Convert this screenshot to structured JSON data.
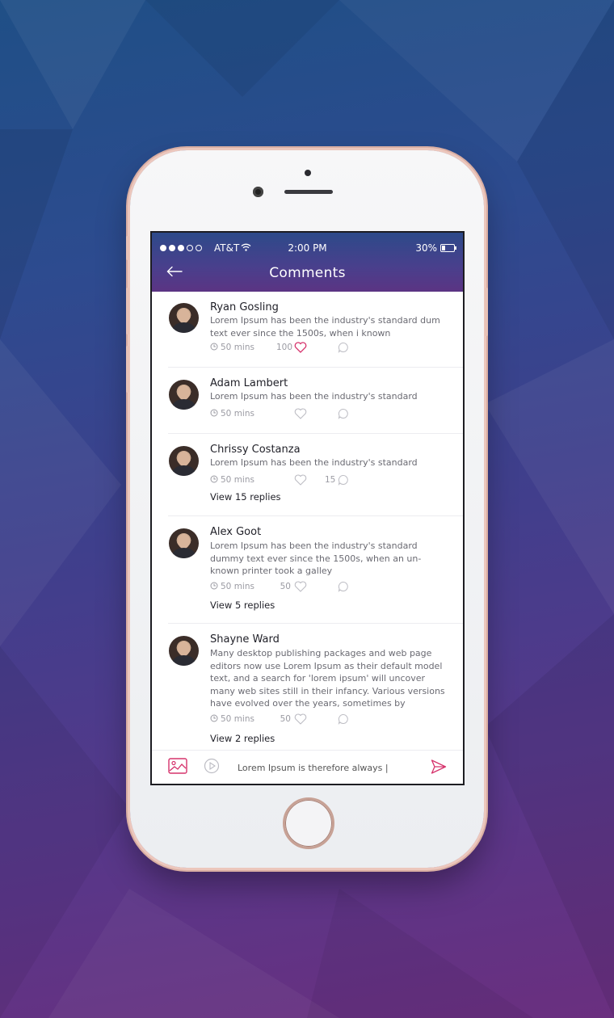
{
  "status_bar": {
    "carrier": "AT&T",
    "time": "2:00 PM",
    "battery": "30%"
  },
  "header": {
    "title": "Comments"
  },
  "comments": [
    {
      "name": "Ryan Gosling",
      "text": "Lorem Ipsum has been the industry's standard dum text ever since the 1500s, when i known",
      "time": "50 mins",
      "likes": "100",
      "liked": true,
      "reply_count": "",
      "view_replies": ""
    },
    {
      "name": "Adam Lambert",
      "text": "Lorem Ipsum has been the industry's standard",
      "time": "50 mins",
      "likes": "",
      "liked": false,
      "reply_count": "",
      "view_replies": ""
    },
    {
      "name": "Chrissy Costanza",
      "text": "Lorem Ipsum has been the industry's standard",
      "time": "50 mins",
      "likes": "",
      "liked": false,
      "reply_count": "15",
      "view_replies": "View 15 replies"
    },
    {
      "name": "Alex Goot",
      "text": "Lorem Ipsum has been the industry's standard dummy text ever since the 1500s, when an un-known printer took a galley",
      "time": "50 mins",
      "likes": "50",
      "liked": false,
      "reply_count": "",
      "view_replies": "View 5 replies"
    },
    {
      "name": "Shayne Ward",
      "text": "Many desktop publishing packages and web page editors now use Lorem Ipsum as their default model text, and a search for 'lorem ipsum' will uncover many web sites still in their infancy. Various versions have evolved over the years, sometimes by accident,",
      "time": "50 mins",
      "likes": "50",
      "liked": false,
      "reply_count": "",
      "view_replies": "View 2 replies"
    }
  ],
  "composer": {
    "value": "Lorem Ipsum is therefore always |"
  },
  "colors": {
    "accent": "#d6336c",
    "header_top": "#2d4a8a",
    "header_bottom": "#5b3483"
  }
}
